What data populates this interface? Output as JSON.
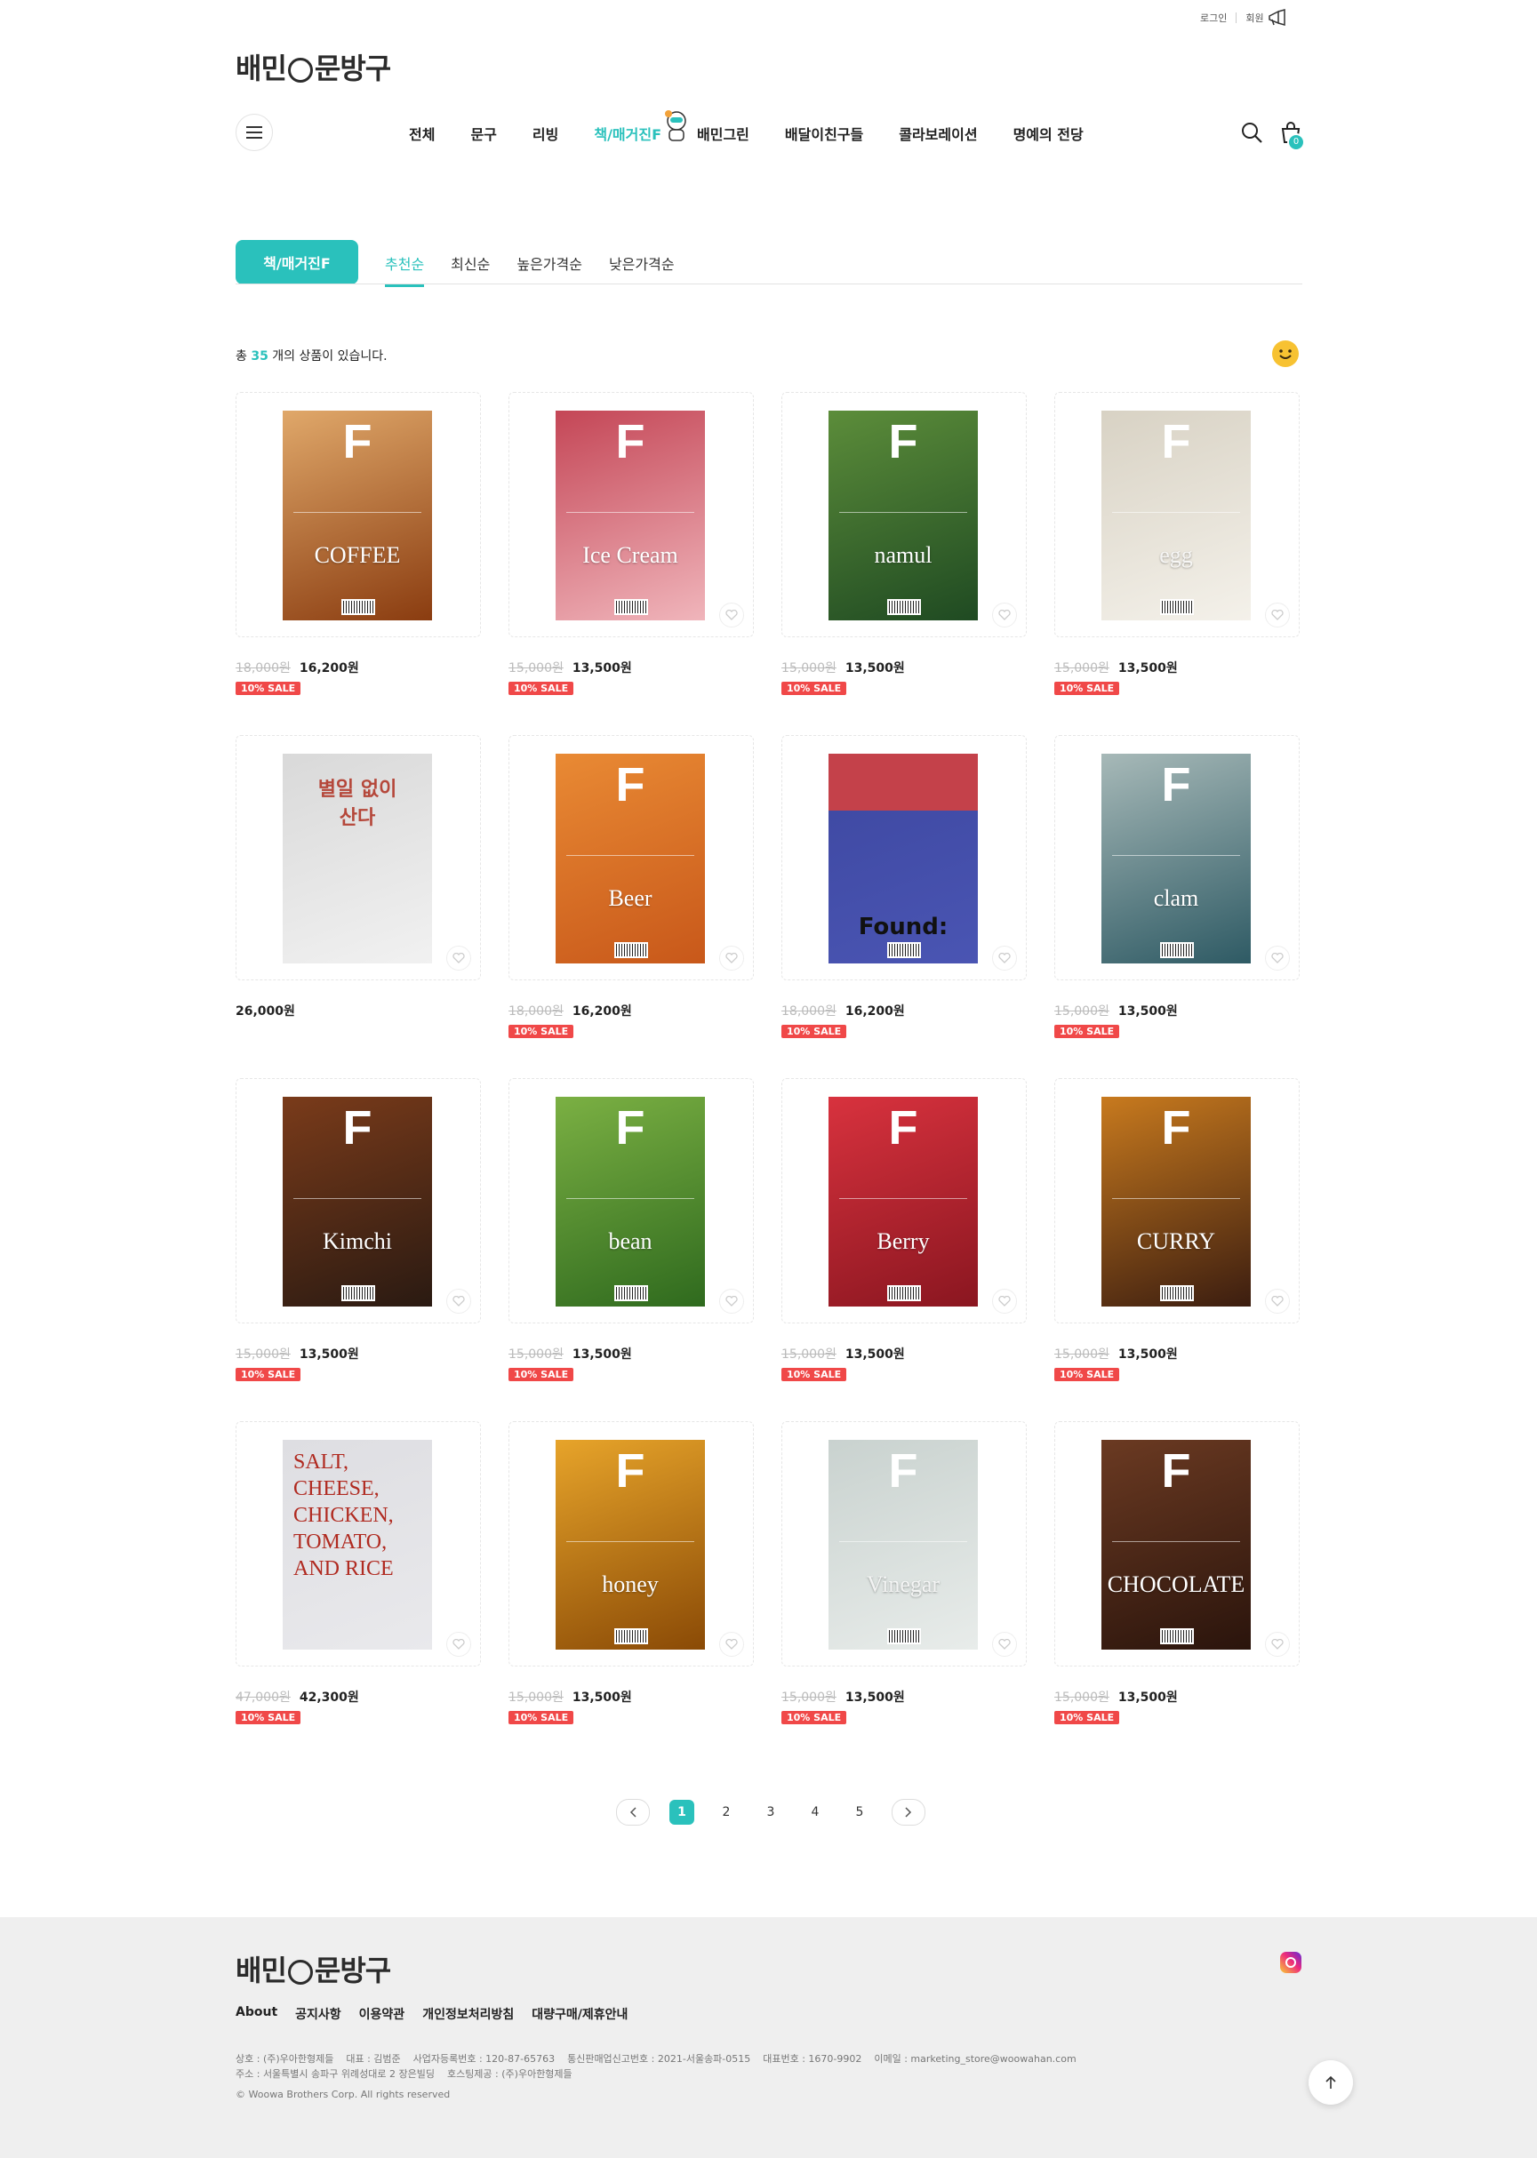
{
  "header": {
    "top_links": [
      "로그인",
      "회원"
    ],
    "logo_text_left": "배민",
    "logo_text_right": "문방구",
    "nav": [
      {
        "label": "전체",
        "active": false
      },
      {
        "label": "문구",
        "active": false
      },
      {
        "label": "리빙",
        "active": false
      },
      {
        "label": "책/매거진F",
        "active": true
      },
      {
        "label": "배민그린",
        "active": false
      },
      {
        "label": "배달이친구들",
        "active": false
      },
      {
        "label": "콜라보레이션",
        "active": false
      },
      {
        "label": "명예의 전당",
        "active": false
      }
    ],
    "cart_count": "0"
  },
  "category": {
    "current": "책/매거진F",
    "sort_tabs": [
      {
        "label": "추천순",
        "active": true
      },
      {
        "label": "최신순",
        "active": false
      },
      {
        "label": "높은가격순",
        "active": false
      },
      {
        "label": "낮은가격순",
        "active": false
      }
    ]
  },
  "listing": {
    "count_prefix": "총",
    "count": "35",
    "count_suffix": "개의 상품이 있습니다."
  },
  "products": [
    {
      "cover_title": "COFFEE",
      "orig_price": "18,000원",
      "price": "16,200원",
      "sale": "10% SALE",
      "colors": [
        "#8a3c10",
        "#e0a86a"
      ]
    },
    {
      "cover_title": "Ice Cream",
      "orig_price": "15,000원",
      "price": "13,500원",
      "sale": "10% SALE",
      "colors": [
        "#f0b5bb",
        "#c44656"
      ]
    },
    {
      "cover_title": "namul",
      "orig_price": "15,000원",
      "price": "13,500원",
      "sale": "10% SALE",
      "colors": [
        "#1f4a22",
        "#5c8d3a"
      ]
    },
    {
      "cover_title": "egg",
      "orig_price": "15,000원",
      "price": "13,500원",
      "sale": "10% SALE",
      "colors": [
        "#f4f1ea",
        "#d8d2c4"
      ]
    },
    {
      "cover_title": "별일 없이 산다",
      "orig_price": "",
      "price": "26,000원",
      "sale": "",
      "colors": [
        "#f1f1f1",
        "#d9d9d9"
      ]
    },
    {
      "cover_title": "Beer",
      "orig_price": "18,000원",
      "price": "16,200원",
      "sale": "10% SALE",
      "colors": [
        "#c8581a",
        "#e98a34"
      ]
    },
    {
      "cover_title": "Found:",
      "orig_price": "18,000원",
      "price": "16,200원",
      "sale": "10% SALE",
      "colors": [
        "#4a55b3",
        "#3d47a0"
      ]
    },
    {
      "cover_title": "clam",
      "orig_price": "15,000원",
      "price": "13,500원",
      "sale": "10% SALE",
      "colors": [
        "#2e5a64",
        "#a7b9b8"
      ]
    },
    {
      "cover_title": "Kimchi",
      "orig_price": "15,000원",
      "price": "13,500원",
      "sale": "10% SALE",
      "colors": [
        "#2a1a12",
        "#7a3b1a"
      ]
    },
    {
      "cover_title": "bean",
      "orig_price": "15,000원",
      "price": "13,500원",
      "sale": "10% SALE",
      "colors": [
        "#2f6a1e",
        "#7bb043"
      ]
    },
    {
      "cover_title": "Berry",
      "orig_price": "15,000원",
      "price": "13,500원",
      "sale": "10% SALE",
      "colors": [
        "#8a1620",
        "#d8323e"
      ]
    },
    {
      "cover_title": "CURRY",
      "orig_price": "15,000원",
      "price": "13,500원",
      "sale": "10% SALE",
      "colors": [
        "#3b1d10",
        "#c87a1e"
      ]
    },
    {
      "cover_title": "SALT, CHEESE, CHICKEN, TOMATO, AND RICE",
      "orig_price": "47,000원",
      "price": "42,300원",
      "sale": "10% SALE",
      "colors": [
        "#e9e9ec",
        "#dedee2"
      ]
    },
    {
      "cover_title": "honey",
      "orig_price": "15,000원",
      "price": "13,500원",
      "sale": "10% SALE",
      "colors": [
        "#8a4a06",
        "#e7a42a"
      ]
    },
    {
      "cover_title": "Vinegar",
      "orig_price": "15,000원",
      "price": "13,500원",
      "sale": "10% SALE",
      "colors": [
        "#e8ecea",
        "#c9d2cf"
      ]
    },
    {
      "cover_title": "CHOCOLATE",
      "orig_price": "15,000원",
      "price": "13,500원",
      "sale": "10% SALE",
      "colors": [
        "#2a140c",
        "#6b3a22"
      ]
    }
  ],
  "pagination": {
    "pages": [
      "1",
      "2",
      "3",
      "4",
      "5"
    ],
    "current": "1"
  },
  "footer": {
    "logo_text_left": "배민",
    "logo_text_right": "문방구",
    "links": [
      "About",
      "공지사항",
      "이용약관",
      "개인정보처리방침",
      "대량구매/제휴안내"
    ],
    "info_line1": "상호 : (주)우아한형제들    대표 : 김범준    사업자등록번호 : 120-87-65763    통신판매업신고번호 : 2021-서울송파-0515    대표번호 : 1670-9902    이메일 : marketing_store@woowahan.com",
    "info_line2": "주소 : 서울특별시 송파구 위례성대로 2 장은빌딩    호스팅제공 : (주)우아한형제들",
    "copyright": "© Woowa Brothers Corp. All rights reserved"
  },
  "icons": {
    "menu": "menu-icon",
    "search": "search-icon",
    "cart": "cart-icon",
    "heart": "heart-icon",
    "instagram": "instagram-icon",
    "top": "arrow-up-icon",
    "megaphone": "megaphone-icon",
    "smile": "smile-icon"
  },
  "colors": {
    "accent": "#2ac1bc",
    "sale": "#f04848",
    "footer_bg": "#efefef"
  }
}
